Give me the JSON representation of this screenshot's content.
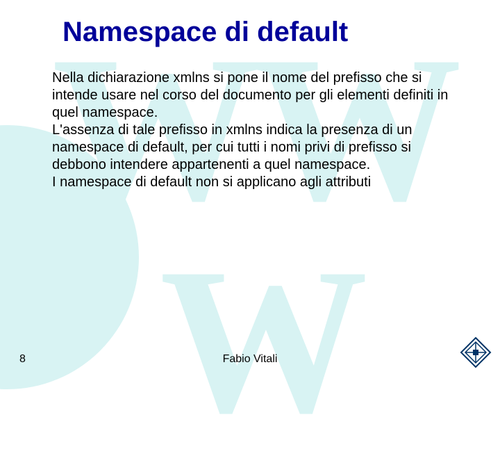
{
  "slide": {
    "title": "Namespace di default",
    "paragraph1": "Nella dichiarazione xmlns si pone il nome del prefisso che si intende usare nel corso del documento per gli elementi definiti in quel namespace.",
    "paragraph2": "L'assenza di tale prefisso in xmlns indica la presenza di un namespace di default, per cui tutti i nomi privi di prefisso si debbono intendere appartenenti a quel namespace.",
    "paragraph3": "I namespace di default non si applicano agli attributi"
  },
  "footer": {
    "page_number": "8",
    "author": "Fabio Vitali"
  },
  "background": {
    "watermark_top": "WW",
    "watermark_bottom": "W"
  }
}
